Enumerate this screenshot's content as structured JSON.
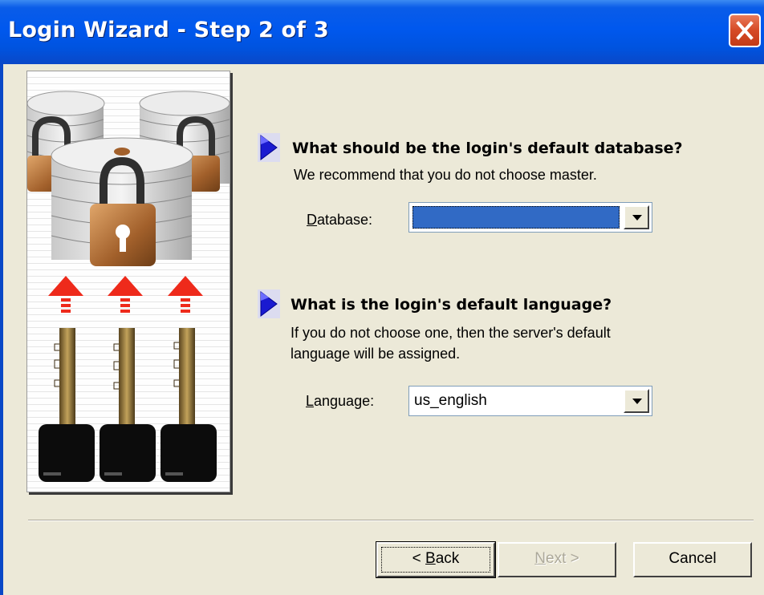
{
  "window": {
    "title": "Login Wizard - Step 2 of 3"
  },
  "icons": {
    "close": "close-icon",
    "pointer": "blue-arrow-icon",
    "illustration": "database-lock-keys-illustration"
  },
  "section_database": {
    "question": "What should be the login's default database?",
    "description": "We recommend that you do not choose master.",
    "label_mnemonic": "D",
    "label_rest": "atabase:",
    "value": ""
  },
  "section_language": {
    "question": "What is the login's default language?",
    "description_line1": "If you do not choose one, then the server's default",
    "description_line2": "language will be assigned.",
    "label_mnemonic": "L",
    "label_rest": "anguage:",
    "value": "us_english"
  },
  "buttons": {
    "back_prefix": "< ",
    "back_mnemonic": "B",
    "back_rest": "ack",
    "next_mnemonic": "N",
    "next_rest": "ext >",
    "cancel": "Cancel"
  },
  "colors": {
    "title_bar": "#0058ee",
    "face": "#ece9d8",
    "selection": "#316ac5",
    "close_button": "#d64a25"
  }
}
